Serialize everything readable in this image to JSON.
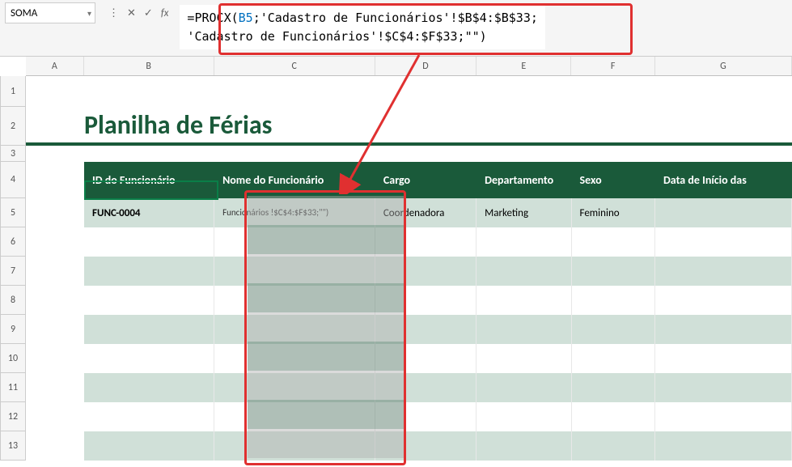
{
  "formula_bar": {
    "name_box": "SOMA",
    "fx_label": "fx",
    "formula_prefix": "=PROCX(",
    "formula_b5": "B5",
    "formula_part2": ";'Cadastro de Funcionários'!$B$4:$B$33;",
    "formula_line2": "'Cadastro de Funcionários'!$C$4:$F$33;\"\")"
  },
  "columns": [
    "A",
    "B",
    "C",
    "D",
    "E",
    "F",
    "G"
  ],
  "rows": [
    "1",
    "2",
    "3",
    "4",
    "5",
    "6",
    "7",
    "8",
    "9",
    "10",
    "11",
    "12",
    "13"
  ],
  "title": "Planilha de Férias",
  "headers": {
    "id": "ID do Funcionário",
    "nome": "Nome do Funcionário",
    "cargo": "Cargo",
    "depto": "Departamento",
    "sexo": "Sexo",
    "data": "Data de Início das"
  },
  "row5": {
    "id": "FUNC-0004",
    "nome_editing": "Funcionários !$C$4:$F$33;\"\")",
    "cargo": "Coordenadora",
    "depto": "Marketing",
    "sexo": "Feminino"
  }
}
